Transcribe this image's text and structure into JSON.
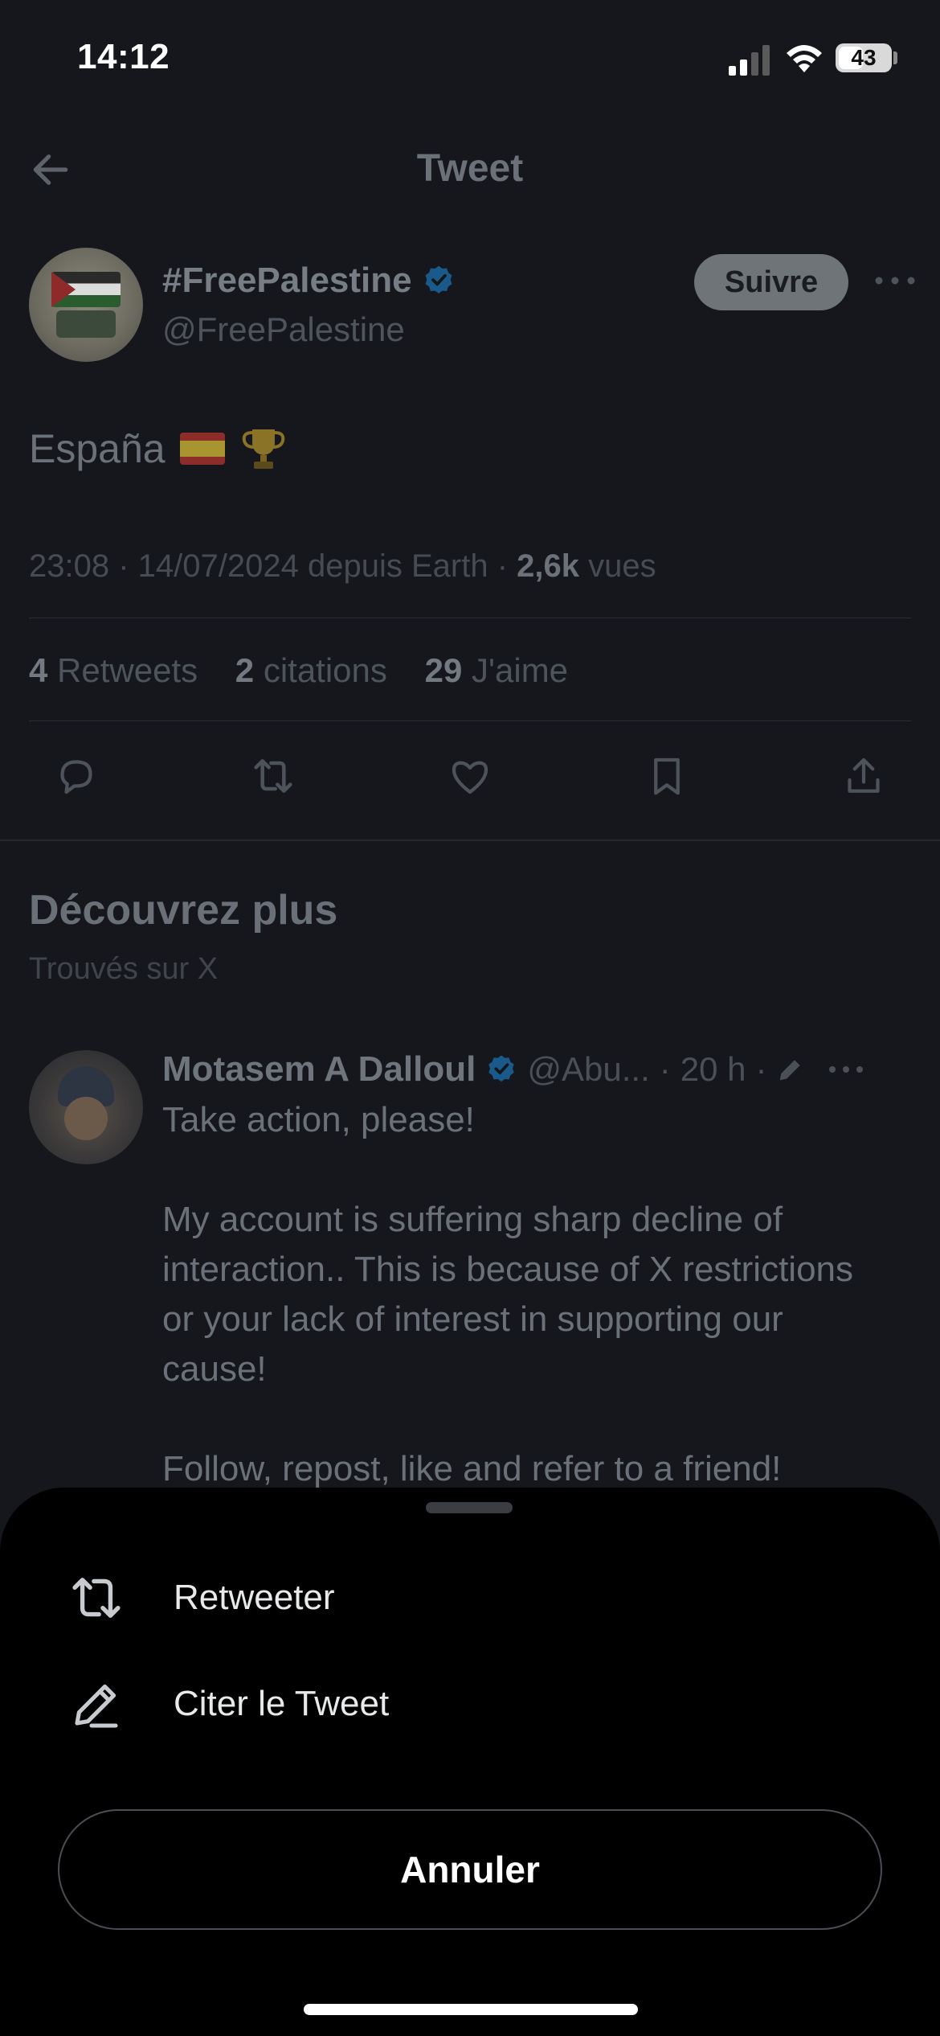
{
  "status_bar": {
    "time": "14:12",
    "battery": "43",
    "signal_icon": "cellular-signal-icon",
    "wifi_icon": "wifi-icon"
  },
  "header": {
    "title": "Tweet",
    "back_icon": "arrow-left-icon"
  },
  "tweet": {
    "author_name": "#FreePalestine",
    "author_handle": "@FreePalestine",
    "follow_label": "Suivre",
    "text": "España",
    "emojis": [
      "spain-flag-emoji",
      "trophy-emoji"
    ],
    "time": "23:08",
    "date": "14/07/2024",
    "source": "depuis Earth",
    "views_count": "2,6k",
    "views_label": "vues",
    "retweets_count": "4",
    "retweets_label": "Retweets",
    "quotes_count": "2",
    "quotes_label": "citations",
    "likes_count": "29",
    "likes_label": "J'aime",
    "actions": [
      "reply-icon",
      "retweet-icon",
      "like-icon",
      "bookmark-icon",
      "share-icon"
    ]
  },
  "discover": {
    "title": "Découvrez plus",
    "subtitle": "Trouvés sur X"
  },
  "tweet2": {
    "author_name": "Motasem A Dalloul",
    "handle": "@Abu...",
    "time": "20 h",
    "line1": "Take action, please!",
    "paragraph2": "My account is suffering sharp decline of interaction.. This is because of X restrictions or your lack of interest in supporting our cause!",
    "paragraph3": "Follow, repost, like and refer to a friend!"
  },
  "sheet": {
    "retweet_label": "Retweeter",
    "quote_label": "Citer le Tweet",
    "cancel_label": "Annuler"
  },
  "colors": {
    "verified": "#1d9bf0",
    "sheet_background": "#000000",
    "screen_background": "#15171c"
  }
}
